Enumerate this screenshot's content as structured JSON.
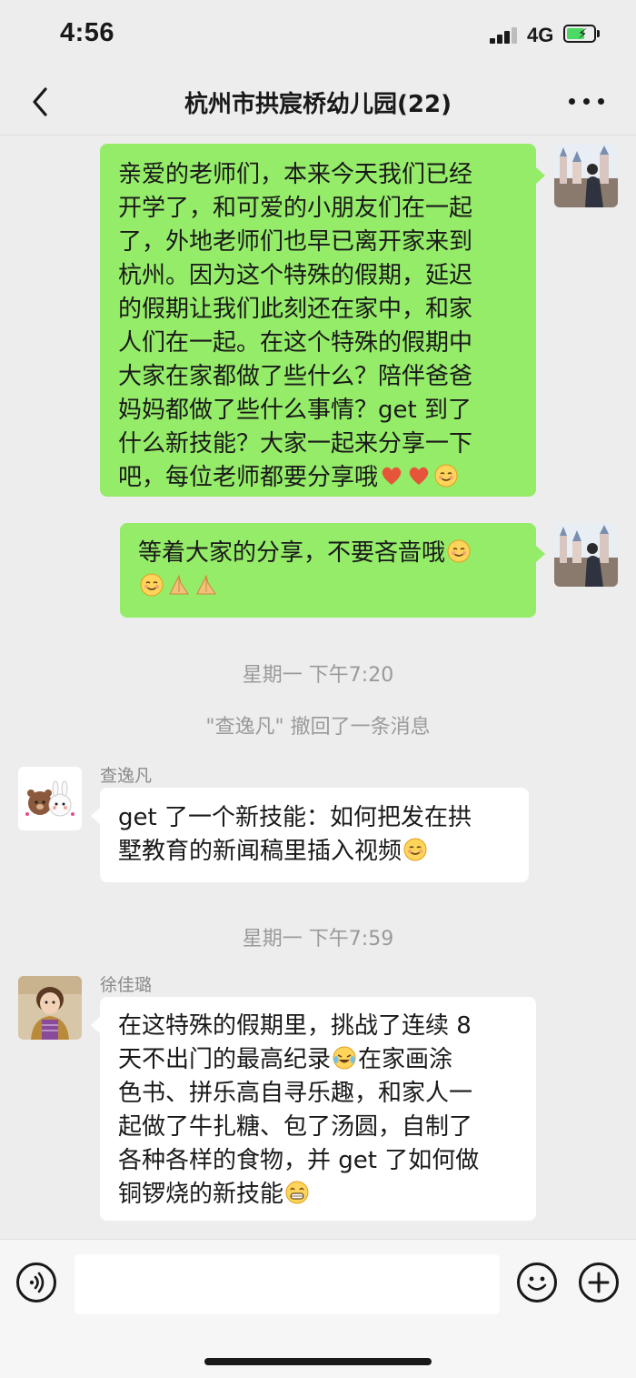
{
  "status_bar": {
    "time": "4:56",
    "network": "4G"
  },
  "header": {
    "title": "杭州市拱宸桥幼儿园(22)"
  },
  "messages": [
    {
      "sender": "me",
      "type": "text",
      "lines": [
        "亲爱的老师们，本来今天我们已经",
        "开学了，和可爱的小朋友们在一起",
        "了，外地老师们也早已离开家来到",
        "杭州。因为这个特殊的假期，延迟",
        "的假期让我们此刻还在家中，和家",
        "人们在一起。在这个特殊的假期中",
        "大家在家都做了些什么？陪伴爸爸",
        "妈妈都做了些什么事情？get 到了",
        "什么新技能？大家一起来分享一下",
        "吧，每位老师都要分享哦"
      ],
      "trailing_emojis": [
        "heart",
        "heart",
        "smile"
      ]
    },
    {
      "sender": "me",
      "type": "text",
      "line1": "等着大家的分享，不要吝啬哦",
      "line1_emojis": [
        "smile"
      ],
      "line2_emojis": [
        "smile",
        "pray",
        "pray"
      ]
    }
  ],
  "timestamp_1": "星期一 下午7:20",
  "recall_notice": "\"查逸凡\" 撤回了一条消息",
  "msg3": {
    "sender_name": "查逸凡",
    "lines": [
      "get 了一个新技能：如何把发在拱",
      "墅教育的新闻稿里插入视频"
    ],
    "trailing_emojis": [
      "smile"
    ]
  },
  "timestamp_2": "星期一 下午7:59",
  "msg4": {
    "sender_name": "徐佳璐",
    "line1": "在这特殊的假期里，挑战了连续 8",
    "line2a": "天不出门的最高纪录",
    "line2b": "在家画涂",
    "line3": "色书、拼乐高自寻乐趣，和家人一",
    "line4": "起做了牛扎糖、包了汤圆，自制了",
    "line5": "各种各样的食物，并 get 了如何做",
    "line6": "铜锣烧的新技能",
    "inline_emojis": [
      "tears-of-joy",
      "grin"
    ]
  },
  "input_bar": {
    "placeholder": ""
  },
  "colors": {
    "background": "#ededed",
    "my_bubble": "#95ec69",
    "their_bubble": "#ffffff",
    "battery": "#4cd964"
  }
}
